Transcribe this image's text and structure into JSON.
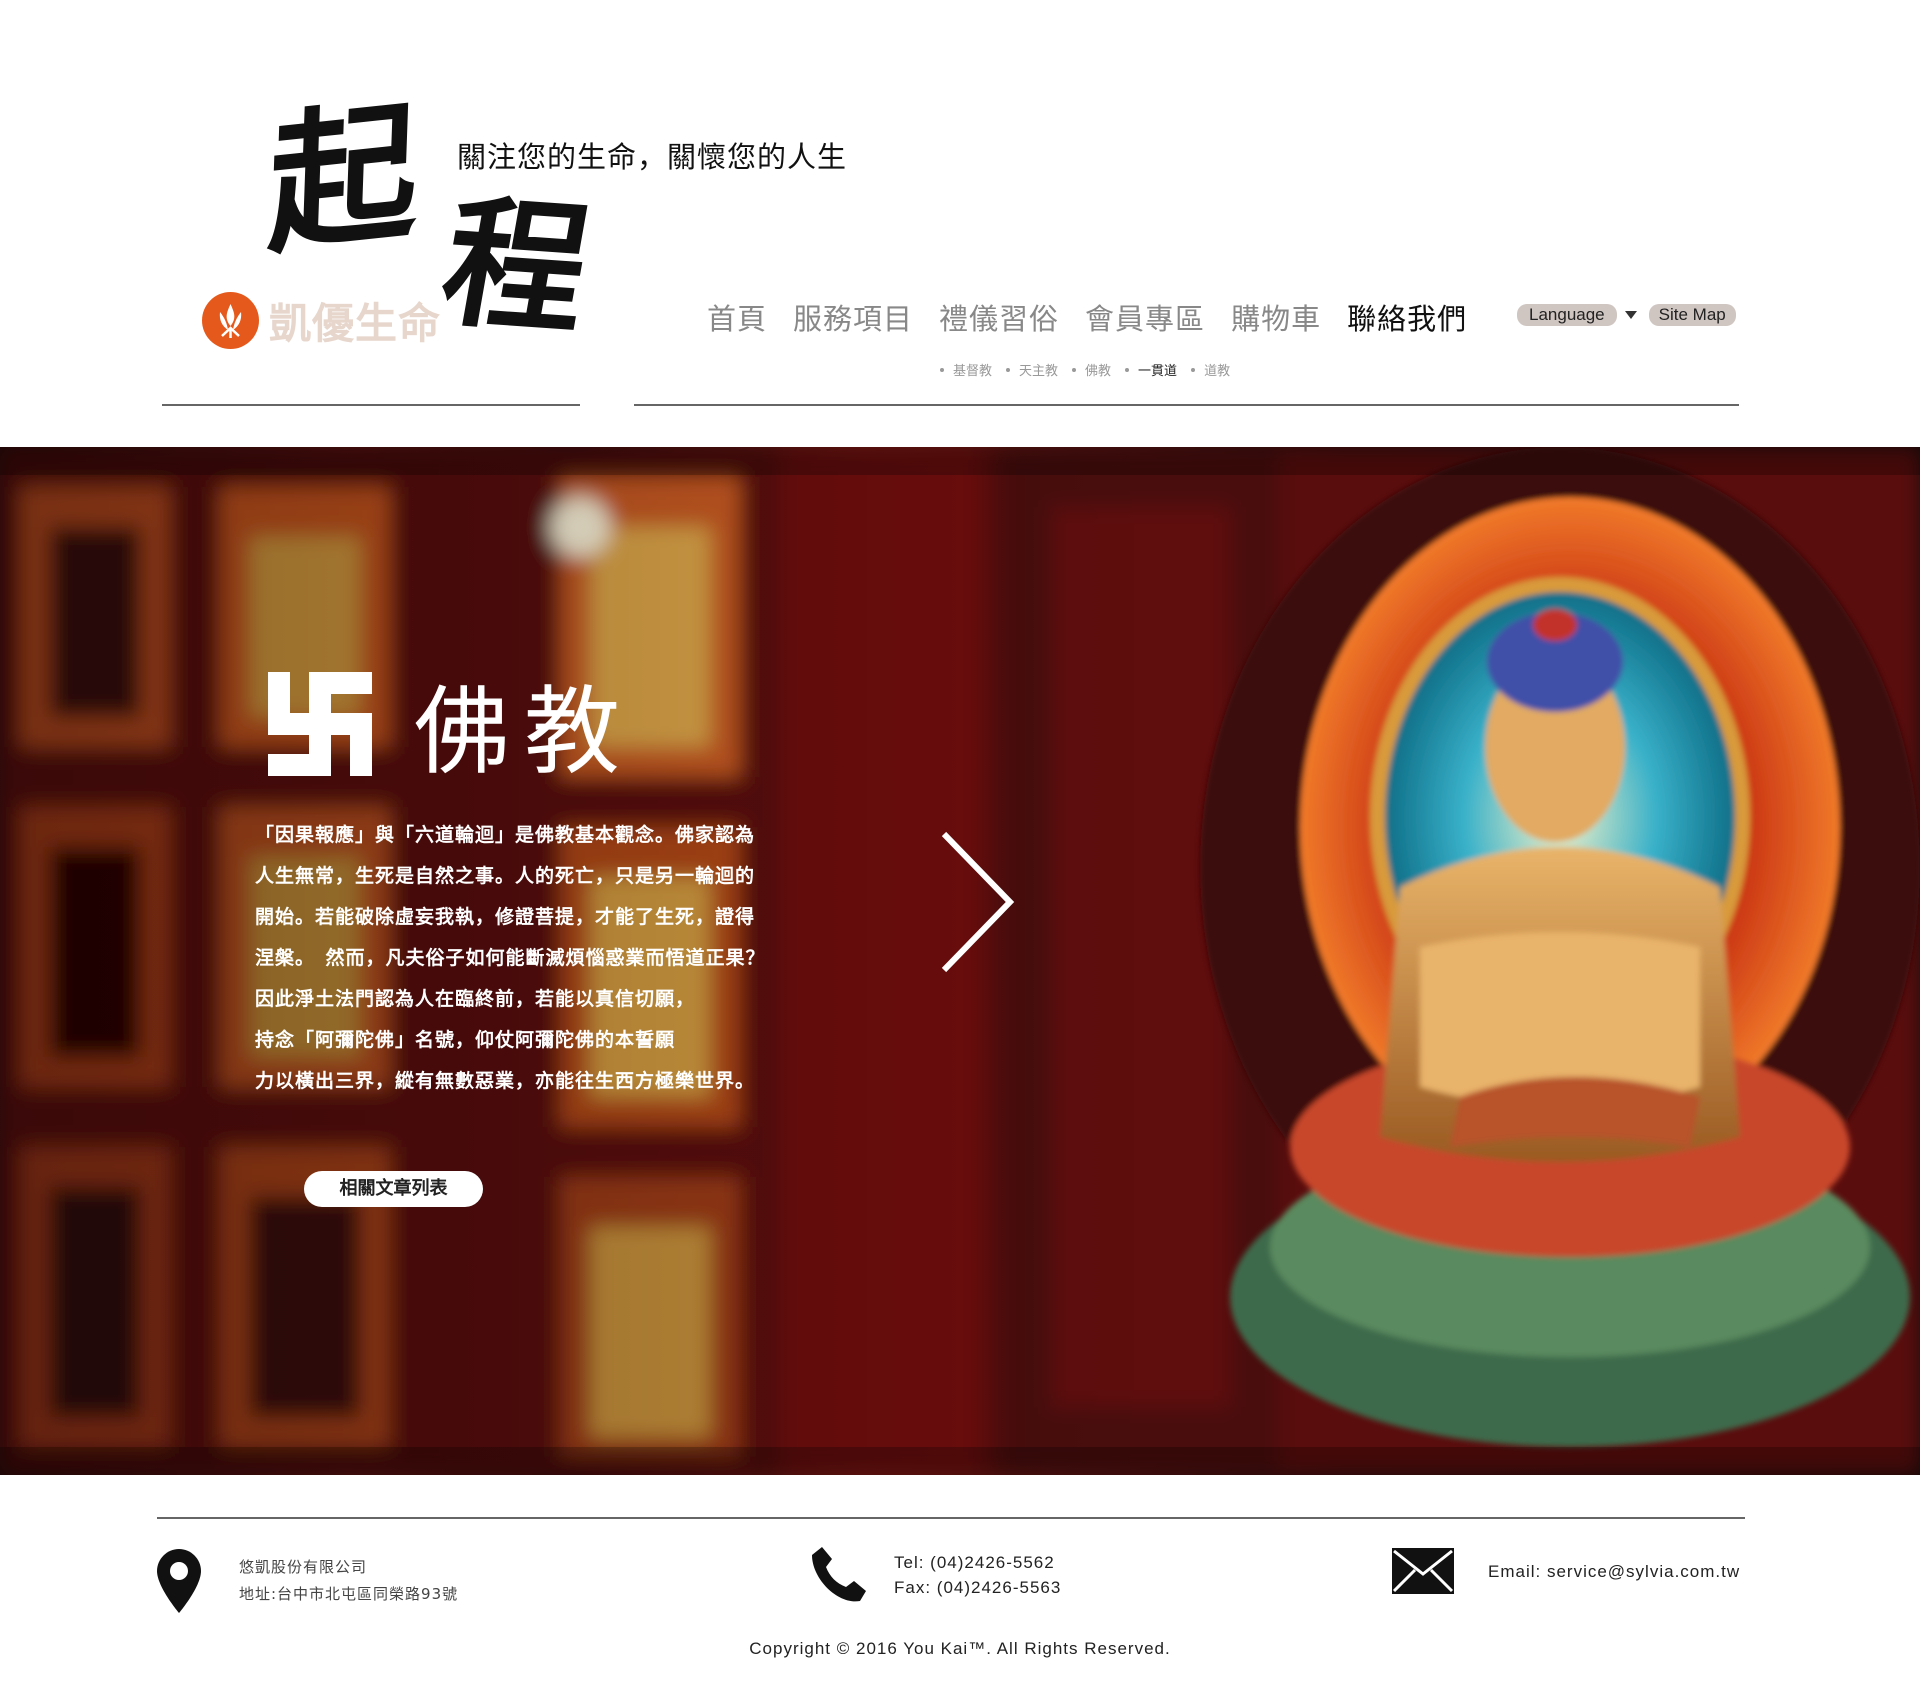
{
  "header": {
    "calligraphy_1": "起",
    "calligraphy_2": "程",
    "slogan": "關注您的生命，關懷您的人生",
    "brand_name": "凱優生命"
  },
  "nav": {
    "items": [
      {
        "label": "首頁",
        "active": false
      },
      {
        "label": "服務項目",
        "active": false
      },
      {
        "label": "禮儀習俗",
        "active": false
      },
      {
        "label": "會員專區",
        "active": false
      },
      {
        "label": "購物車",
        "active": false
      },
      {
        "label": "聯絡我們",
        "active": true
      }
    ],
    "language_label": "Language",
    "sitemap_label": "Site Map"
  },
  "sub_nav": {
    "items": [
      {
        "label": "基督教",
        "active": false
      },
      {
        "label": "天主教",
        "active": false
      },
      {
        "label": "佛教",
        "active": false
      },
      {
        "label": "一貫道",
        "active": true
      },
      {
        "label": "道教",
        "active": false
      }
    ]
  },
  "hero": {
    "heading": "佛教",
    "paragraph_lines": [
      "「因果報應」與「六道輪迴」是佛教基本觀念。佛家認為",
      "人生無常，生死是自然之事。人的死亡，只是另一輪迴的",
      "開始。若能破除虛妄我執，修證菩提，才能了生死，證得",
      "涅槃。　然而，凡夫俗子如何能斷滅煩惱惑業而悟道正果？",
      "因此淨土法門認為人在臨終前，若能以真信切願，",
      "持念「阿彌陀佛」名號，仰仗阿彌陀佛的本誓願",
      "力以橫出三界，縱有無數惡業，亦能往生西方極樂世界。"
    ],
    "button_label": "相關文章列表"
  },
  "footer": {
    "company": "悠凱股份有限公司",
    "address": "地址:台中市北屯區同榮路93號",
    "tel": "Tel: (04)2426-5562",
    "fax": "Fax: (04)2426-5563",
    "email": "Email: service@sylvia.com.tw",
    "copyright": "Copyright © 2016 You Kai™. All Rights Reserved."
  },
  "colors": {
    "brand_orange": "#e55a1c",
    "nav_inactive": "#888888",
    "nav_active": "#111111",
    "pill_bg": "#cfc5c1"
  },
  "icons": [
    "location-pin-icon",
    "phone-icon",
    "envelope-icon",
    "chevron-right-icon",
    "swastika-icon",
    "dropdown-arrow-icon"
  ]
}
